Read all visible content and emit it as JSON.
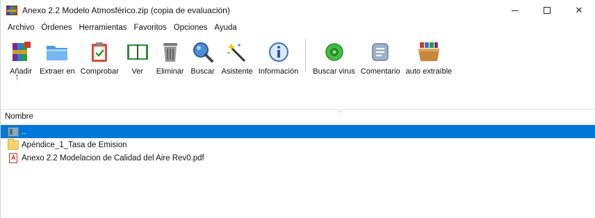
{
  "window": {
    "title": "Anexo 2.2 Modelo Atmosférico.zip (copia de evaluación)",
    "controls": {
      "minimize": "minimize",
      "maximize": "maximize",
      "close": "✕"
    }
  },
  "menu": [
    "Archivo",
    "Órdenes",
    "Herramientas",
    "Favoritos",
    "Opciones",
    "Ayuda"
  ],
  "toolbar": {
    "add": "Añadir",
    "extract": "Extraer en",
    "test": "Comprobar",
    "view": "Ver",
    "delete": "Eliminar",
    "find": "Buscar",
    "wizard": "Asistente",
    "info": "Información",
    "virus_scan": "Buscar virus",
    "comment": "Comentario",
    "sfx": "auto extraíble",
    "up_arrow": "↑"
  },
  "file_list": {
    "column_name": "Nombre",
    "rows": [
      {
        "name": "..",
        "type": "parent",
        "selected": true
      },
      {
        "name": "Apéndice_1_Tasa de Emision",
        "type": "folder",
        "selected": false
      },
      {
        "name": "Anexo 2.2 Modelacion de Calidad del Aire Rev0.pdf",
        "type": "pdf",
        "selected": false
      }
    ]
  },
  "colors": {
    "selection": "#0078d7"
  }
}
